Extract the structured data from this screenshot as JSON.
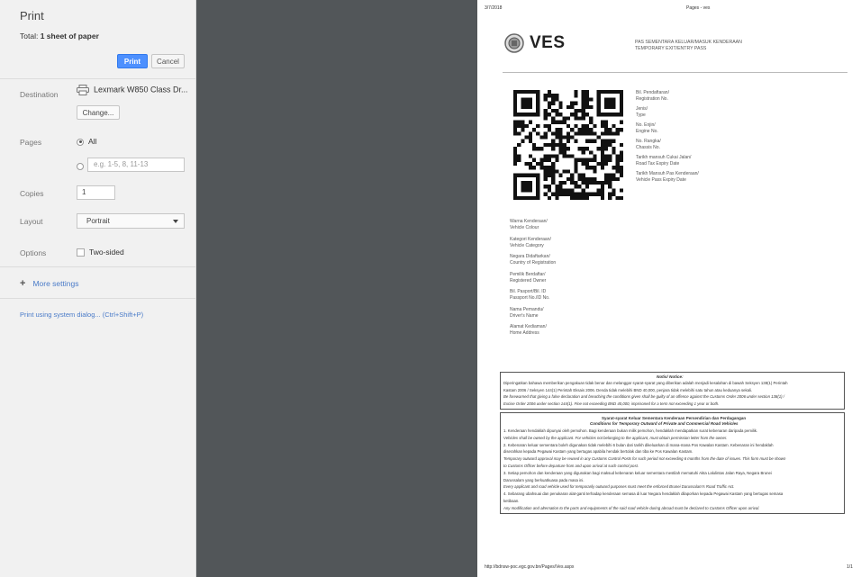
{
  "dialog": {
    "title": "Print",
    "total_label": "Total:",
    "total_value": "1 sheet of paper",
    "print_button": "Print",
    "cancel_button": "Cancel",
    "destination_label": "Destination",
    "destination_value": "Lexmark W850 Class Dr...",
    "change_button": "Change...",
    "pages_label": "Pages",
    "pages_all": "All",
    "pages_placeholder": "e.g. 1-5, 8, 11-13",
    "copies_label": "Copies",
    "copies_value": "1",
    "layout_label": "Layout",
    "layout_value": "Portrait",
    "options_label": "Options",
    "two_sided": "Two-sided",
    "more_settings": "More settings",
    "system_dialog": "Print using system dialog... (Ctrl+Shift+P)"
  },
  "preview": {
    "date": "3/7/2018",
    "page_title": "Pages - ves",
    "logo_text": "VES",
    "pass_title_1": "PAS SEMENTARA KELUAR/MASUK KENDERAAN",
    "pass_title_2": "TEMPORARY EXIT/ENTRY PASS",
    "right_fields": [
      [
        "Bil. Pendaftaran/",
        "Registration No."
      ],
      [
        "Jenis/",
        "Type"
      ],
      [
        "No. Enjin/",
        "Engine No."
      ],
      [
        "No. Rangka/",
        "Chassis No."
      ],
      [
        "Tarikh mansuh Cukai Jalan/",
        "Road Tax Expiry Date"
      ],
      [
        "Tarikh Mansuh Pas Kenderaan/",
        "Vehicle Pass Expiry Date"
      ]
    ],
    "left_fields": [
      [
        "Warna Kenderaan/",
        "Vehicle Colour"
      ],
      [
        "Kategori Kenderaan/",
        "Vehicle Category"
      ],
      [
        "Negara Didaftarkan/",
        "Country of Registration"
      ],
      [
        "Pemilik Berdaftar/",
        "Registered Owner"
      ],
      [
        "Bil. Pasport/Bil. ID",
        "Passport No./ID No."
      ],
      [
        "Nama Pemandu/",
        "Driver's Name"
      ],
      [
        "Alamat Kediaman/",
        "Home Address"
      ]
    ],
    "notice_title": "Notis/ Notice:",
    "notice_lines": [
      "Diperingatkan bahawa memberikan pengakuan tidak benar dan melanggar syarat-syarat yang diberikan adalah menjadi kesalahan di bawah Seksyen 138(1) Perintah",
      "Kastam 2006 / Seksyen 144(1) Perintah Eksais 2006. Denda tidak melebihi BND 40,000, penjara tidak melebihi satu tahun atau keduanya sekali.",
      "Be forewarned that giving a false declaration and breaching the conditions given shall be guilty of an offence against the Customs Order 2006 under section 138(1) /",
      "Excise Order 2006 under section 144(1). Fine not exceeding BND 40,000, imprisoned for a term not exceeding 1 year or both."
    ],
    "conditions_title_1": "Syarat-syarat Keluar Sementara Kenderaan Persendirian dan Perdagangan",
    "conditions_title_2": "Conditions for Temporary Outward of Private and Commercial Road Vehicles",
    "conditions_lines": [
      "1.   Kenderaan hendaklah dipunyai oleh pemohon. Bagi kenderaan bukan milik pemohon, hendaklah mendapatkan surat kebenaran daripada pemilik.",
      "      Vehicles shall be owned by the applicant. For vehicles not belonging to the applicant, must obtain permission letter from the owner.",
      "2.   Kebenaran keluar sementara boleh digunakan tidak melebihi 6 bulan dari tarikh dikeluarkan di mana-mana Pos Kawalan Kastam. Kebenaran ini hendaklah",
      "      diserahkan kepada Pegawai Kastam yang bertugas apabila hendak bertolak dan tiba ke Pos Kawalan Kastam.",
      "      Temporary outward approval may be reused in any Customs Control Posts for such period not exceeding 6 months from the date of issues. This form must be shown",
      "      to Customs Officer before departure from and upon arrival at such control post.",
      "3.   Setiap pemohon dan kenderaan yang digunakan bagi maksud kebenaran keluar sementara mestilah mematuhi Akta Lalulintas Jalan Raya, Negara Brunei",
      "      Darussalam yang berkuatkuasa pada masa ini.",
      "      Every applicant and road vehicle used for temporarily outward purposes must meet the enforced Brunei Darussalam's Road Traffic Act.",
      "4.   Sebarang ubahsuai dan penukaran alat-ganti terhadap kenderaan semasa di luar Negara hendaklah dilaporkan kepada Pegawai Kastam yang bertugas semasa",
      "      ketibaan.",
      "      Any modification and alternation to the parts and equipments of the said road vehicle during abroad must be declared to Customs Officer upon arrival."
    ],
    "footer_url": "http://bdnsw-poc.egc.gov.bn/Pages/Ves.aspx",
    "footer_page": "1/1"
  }
}
